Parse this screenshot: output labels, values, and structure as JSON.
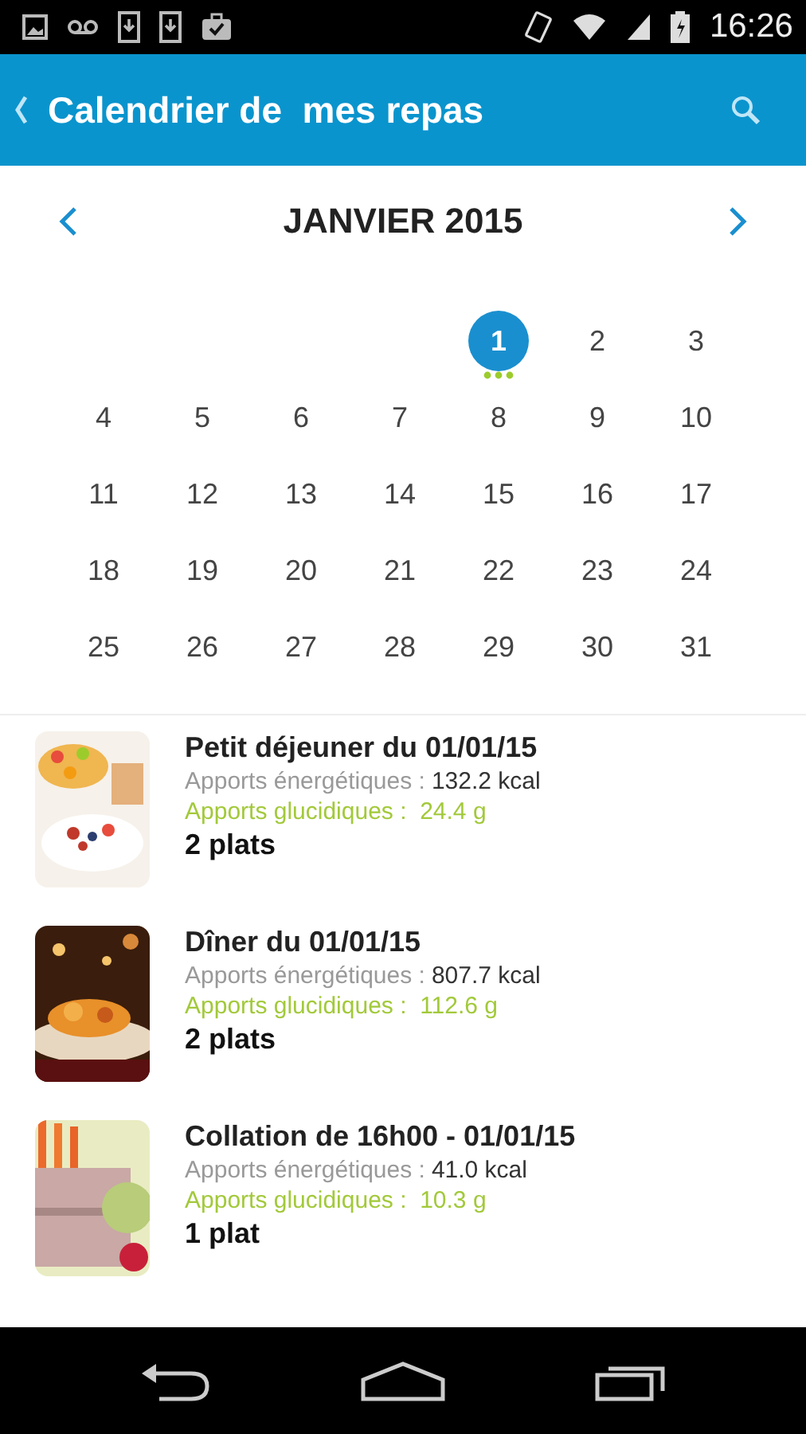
{
  "status_bar": {
    "time": "16:26"
  },
  "app_bar": {
    "title": "Calendrier de  mes repas"
  },
  "calendar": {
    "month": "JANVIER 2015",
    "days": [
      {
        "day": "1",
        "selected": true,
        "has_meals": true
      },
      {
        "day": "2",
        "selected": false,
        "has_meals": false
      },
      {
        "day": "3",
        "selected": false,
        "has_meals": false
      },
      {
        "day": "4",
        "selected": false,
        "has_meals": false
      },
      {
        "day": "5",
        "selected": false,
        "has_meals": false
      },
      {
        "day": "6",
        "selected": false,
        "has_meals": false
      },
      {
        "day": "7",
        "selected": false,
        "has_meals": false
      },
      {
        "day": "8",
        "selected": false,
        "has_meals": false
      },
      {
        "day": "9",
        "selected": false,
        "has_meals": false
      },
      {
        "day": "10",
        "selected": false,
        "has_meals": false
      },
      {
        "day": "11",
        "selected": false,
        "has_meals": false
      },
      {
        "day": "12",
        "selected": false,
        "has_meals": false
      },
      {
        "day": "13",
        "selected": false,
        "has_meals": false
      },
      {
        "day": "14",
        "selected": false,
        "has_meals": false
      },
      {
        "day": "15",
        "selected": false,
        "has_meals": false
      },
      {
        "day": "16",
        "selected": false,
        "has_meals": false
      },
      {
        "day": "17",
        "selected": false,
        "has_meals": false
      },
      {
        "day": "18",
        "selected": false,
        "has_meals": false
      },
      {
        "day": "19",
        "selected": false,
        "has_meals": false
      },
      {
        "day": "20",
        "selected": false,
        "has_meals": false
      },
      {
        "day": "21",
        "selected": false,
        "has_meals": false
      },
      {
        "day": "22",
        "selected": false,
        "has_meals": false
      },
      {
        "day": "23",
        "selected": false,
        "has_meals": false
      },
      {
        "day": "24",
        "selected": false,
        "has_meals": false
      },
      {
        "day": "25",
        "selected": false,
        "has_meals": false
      },
      {
        "day": "26",
        "selected": false,
        "has_meals": false
      },
      {
        "day": "27",
        "selected": false,
        "has_meals": false
      },
      {
        "day": "28",
        "selected": false,
        "has_meals": false
      },
      {
        "day": "29",
        "selected": false,
        "has_meals": false
      },
      {
        "day": "30",
        "selected": false,
        "has_meals": false
      },
      {
        "day": "31",
        "selected": false,
        "has_meals": false
      }
    ]
  },
  "meals": [
    {
      "kind": "breakfast",
      "title": "Petit déjeuner du 01/01/15",
      "energy_label": "Apports énergétiques :",
      "energy_value": "132.2 kcal",
      "carbs": "Apports glucidiques :  24.4 g",
      "dishes": "2 plats"
    },
    {
      "kind": "dinner",
      "title": "Dîner du 01/01/15",
      "energy_label": "Apports énergétiques :",
      "energy_value": "807.7 kcal",
      "carbs": "Apports glucidiques :  112.6 g",
      "dishes": "2 plats"
    },
    {
      "kind": "snack",
      "title": "Collation de 16h00 - 01/01/15",
      "energy_label": "Apports énergétiques :",
      "energy_value": "41.0 kcal",
      "carbs": "Apports glucidiques :  10.3 g",
      "dishes": "1 plat"
    }
  ]
}
